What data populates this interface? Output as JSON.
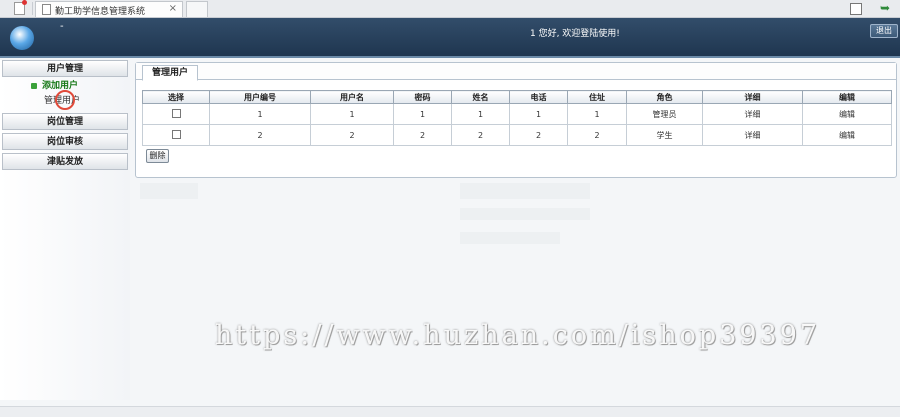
{
  "browser": {
    "tab_title": "勤工助学信息管理系统",
    "tab_close": "×"
  },
  "header": {
    "logo_text": "-",
    "welcome": "1 您好, 欢迎登陆使用!",
    "logout_label": "退出"
  },
  "sidebar": {
    "sections": [
      {
        "label": "用户管理"
      },
      {
        "label": "岗位管理"
      },
      {
        "label": "岗位审核"
      },
      {
        "label": "津贴发放"
      }
    ],
    "user_sub": [
      {
        "label": "添加用户"
      },
      {
        "label": "管理用户"
      }
    ]
  },
  "content": {
    "tab_label": "管理用户",
    "columns": [
      "选择",
      "用户编号",
      "用户名",
      "密码",
      "姓名",
      "电话",
      "住址",
      "角色",
      "详细",
      "编辑"
    ],
    "rows": [
      {
        "id": "1",
        "username": "1",
        "password": "1",
        "name": "1",
        "phone": "1",
        "address": "1",
        "role": "管理员",
        "detail": "详细",
        "edit": "编辑"
      },
      {
        "id": "2",
        "username": "2",
        "password": "2",
        "name": "2",
        "phone": "2",
        "address": "2",
        "role": "学生",
        "detail": "详细",
        "edit": "编辑"
      }
    ],
    "delete_label": "删除"
  },
  "watermark": "https://www.huzhan.com/ishop39397"
}
